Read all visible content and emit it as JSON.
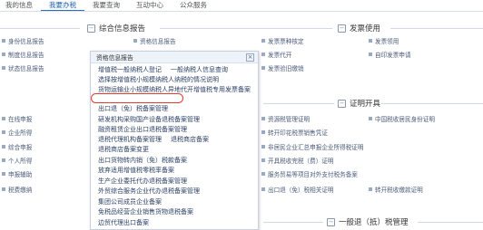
{
  "nav": {
    "tabs": [
      "我的信息",
      "我要办税",
      "我要查询",
      "互动中心",
      "公众服务"
    ]
  },
  "sections": {
    "left": "综合信息报告",
    "right_top": "发票使用",
    "right_mid": "证明开具",
    "bottom": "一般退（抵）税管理"
  },
  "left_col_a": [
    "身份信息报告",
    "制度信息报告",
    "状态信息报告",
    "",
    "在线申报",
    "企业所得",
    "综合申报",
    "个人所得",
    "申报辅助",
    "税费缴纳"
  ],
  "left_col_b": [
    "资格信息报告"
  ],
  "right_col_a": [
    "发票票种核定",
    "发票代开",
    "发票验旧缴销",
    "",
    "资源税管理证明",
    "转开印花税票销售凭证",
    "非居民企业汇总申报企业所得税证明",
    "开具税收完税（费）证明",
    "服务贸易等项目对外支付税务备案",
    "出口退（免）税相关证明"
  ],
  "right_col_b": [
    "发票领用",
    "自印发票申请",
    "",
    "",
    "中国税收居民身份证明",
    "",
    "",
    "",
    "",
    "转开税收缴款证明"
  ],
  "panel": {
    "title": "资格信息报告",
    "close": "×",
    "rows": [
      [
        "增值税一般纳税人登记",
        "一般纳税人信息查询"
      ],
      [
        "选择按增值税小规模纳税人纳税的情况说明"
      ],
      [
        "货物运输业小规模纳税人异地代开增值税专用发票备案"
      ],
      [
        "出口退（免）税备案管理"
      ],
      [
        "研发机构采购国产设备退税备案管理"
      ],
      [
        "融资租赁企业出口退税备案管理"
      ],
      [
        "退税代理机构备案管理",
        "退税商店备案"
      ],
      [
        "退税商店备案变更"
      ],
      [
        "出口货物转内销（免）税款备案"
      ],
      [
        "放弃适用增值税零税率备案"
      ],
      [
        "生产企业委托代办退税备案管理"
      ],
      [
        "外贸综合服务企业代办退税备案管理"
      ],
      [
        "集团公司成员企业备案"
      ],
      [
        "免税品经营企业销售货物退税备案"
      ],
      [
        "边贸代理出口备案"
      ]
    ]
  }
}
